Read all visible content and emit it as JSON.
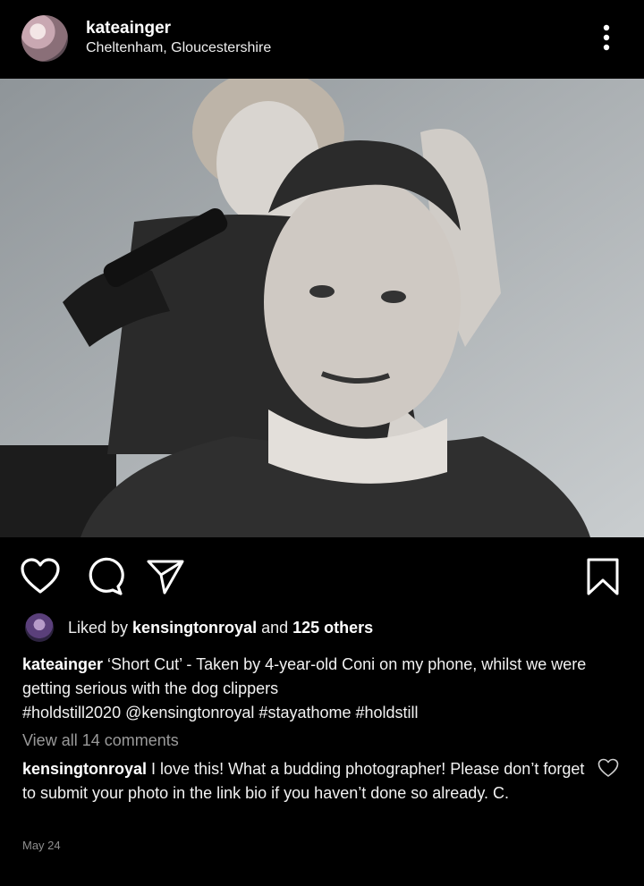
{
  "post": {
    "username": "kateainger",
    "location": "Cheltenham, Gloucestershire"
  },
  "icons": {
    "more": "more-vertical-icon",
    "like": "heart-icon",
    "comment": "comment-icon",
    "share": "send-icon",
    "save": "bookmark-icon"
  },
  "likes": {
    "prefix": "Liked by ",
    "user": "kensingtonroyal",
    "middle": " and ",
    "others": "125 others"
  },
  "caption": {
    "username": "kateainger",
    "text": " ‘Short Cut’ - Taken by 4-year-old Coni on my phone, whilst we were getting serious with the dog clippers",
    "tags": "#holdstill2020 @kensingtonroyal #stayathome #holdstill"
  },
  "comments": {
    "view_all": "View all 14 comments",
    "items": [
      {
        "username": "kensingtonroyal",
        "text": " I love this! What a budding photographer! Please don’t forget to submit your photo in the link bio if you haven’t done so already. C."
      }
    ]
  },
  "date": "May 24"
}
